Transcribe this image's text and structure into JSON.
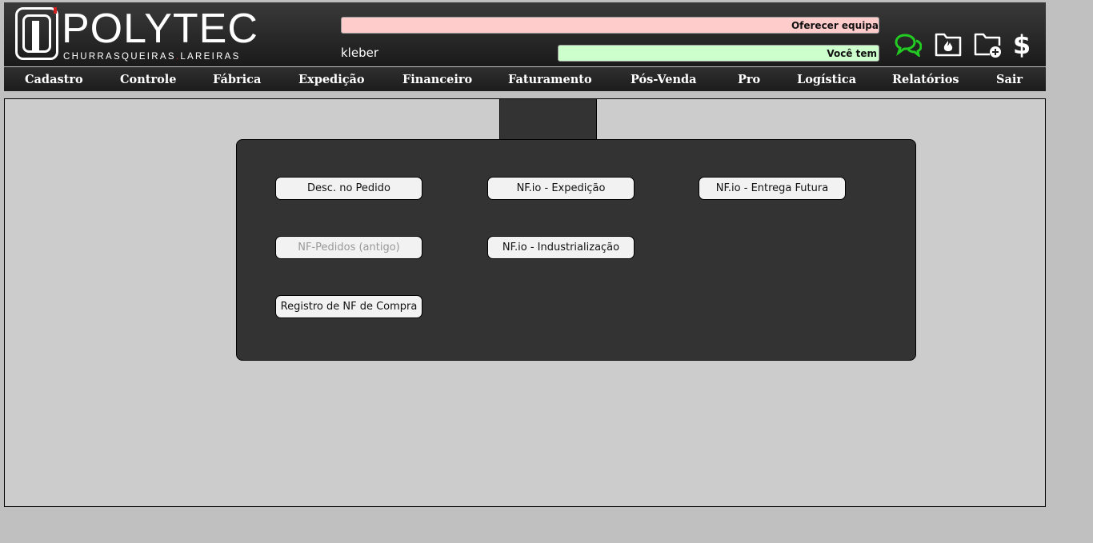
{
  "header": {
    "logo_text": "POLYTEC",
    "logo_subtitle_left": "CHURRASQUEIRAS",
    "logo_subtitle_sep": ".",
    "logo_subtitle_right": "LAREIRAS",
    "ticker_top": "Oferecer equipa",
    "ticker_bottom": "Você tem",
    "username": "kleber",
    "icons": [
      "chat-icon",
      "fire-folder-icon",
      "folder-add-icon",
      "dollar-icon"
    ],
    "colors": {
      "ticker_top_bg": "#ffcccc",
      "ticker_bottom_bg": "#ccffcc",
      "chat_icon": "#22cc22"
    }
  },
  "nav": {
    "items": [
      "Cadastro",
      "Controle",
      "Fábrica",
      "Expedição",
      "Financeiro",
      "Faturamento",
      "Pós-Venda",
      "Pro",
      "Logística",
      "Relatórios",
      "Sair"
    ]
  },
  "panel": {
    "buttons": [
      {
        "label": "Desc. no Pedido",
        "enabled": true
      },
      {
        "label": "NF.io - Expedição",
        "enabled": true
      },
      {
        "label": "NF.io - Entrega Futura",
        "enabled": true
      },
      {
        "label": "NF-Pedidos (antigo)",
        "enabled": false
      },
      {
        "label": "NF.io - Industrialização",
        "enabled": true
      },
      {
        "label": "Registro de NF de Compra",
        "enabled": true
      }
    ]
  }
}
